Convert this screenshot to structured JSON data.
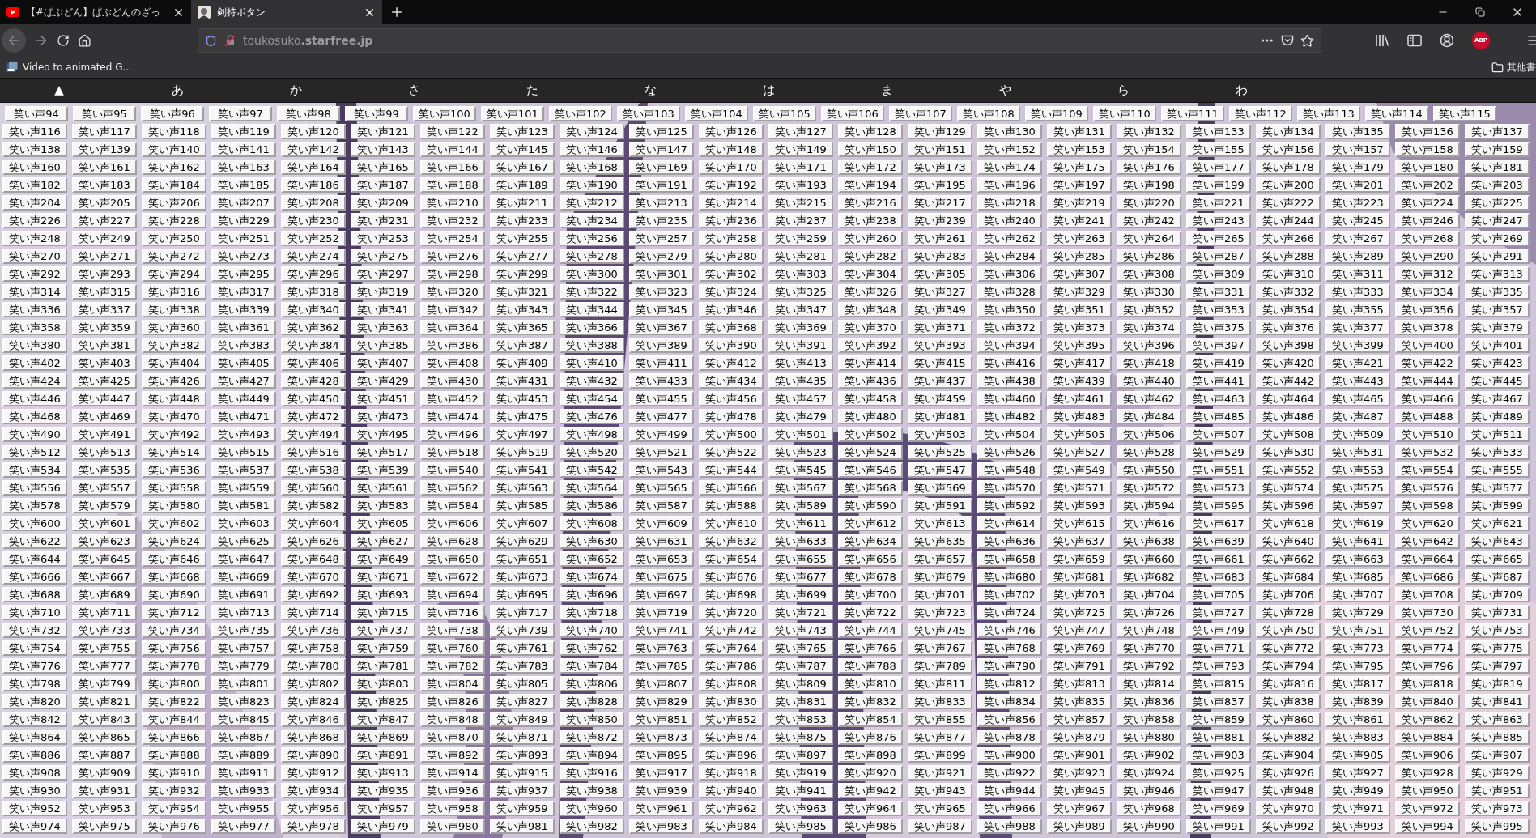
{
  "tabs": [
    {
      "title": "【#ぱぶどん】ぱぶどんのざっ",
      "kind": "youtube",
      "selected": false
    },
    {
      "title": "剣持ボタン",
      "kind": "avatar",
      "selected": true
    }
  ],
  "address": "toukosuko**.starfree.jp**",
  "addon_badge": "ABP",
  "bookmarks": [
    {
      "label": "Video to animated G..."
    }
  ],
  "other_bookmarks": "其他書",
  "index_links": [
    "▲",
    "あ",
    "か",
    "さ",
    "た",
    "な",
    "は",
    "ま",
    "や",
    "ら",
    "わ"
  ],
  "button_rows": [
    [
      "笑い声94",
      "笑い声95",
      "笑い声96",
      "笑い声97",
      "笑い声98",
      "笑い声99",
      "笑い声100",
      "笑い声101",
      "笑い声102",
      "笑い声103",
      "笑い声104",
      "笑い声105",
      "笑い声106",
      "笑い声107",
      "笑い声108",
      "笑い声109",
      "笑い声110",
      "笑い声111",
      "笑い声112",
      "笑い声113",
      "笑い声114",
      "笑い声115"
    ],
    [
      "笑い声116",
      "笑い声117",
      "笑い声118",
      "笑い声119",
      "笑い声120",
      "笑い声121",
      "笑い声122",
      "笑い声123",
      "笑い声124",
      "笑い声125",
      "笑い声126",
      "笑い声127",
      "笑い声128",
      "笑い声129",
      "笑い声130",
      "笑い声131",
      "笑い声132",
      "笑い声133",
      "笑い声134",
      "笑い声135",
      "笑い声136",
      "笑い声137"
    ],
    [
      "笑い声138",
      "笑い声139",
      "笑い声140",
      "笑い声141",
      "笑い声142",
      "笑い声143",
      "笑い声144",
      "笑い声145",
      "笑い声146",
      "笑い声147",
      "笑い声148",
      "笑い声149",
      "笑い声150",
      "笑い声151",
      "笑い声152",
      "笑い声153",
      "笑い声154",
      "笑い声155",
      "笑い声156",
      "笑い声157",
      "笑い声158",
      "笑い声159"
    ],
    [
      "笑い声160",
      "笑い声161",
      "笑い声162",
      "笑い声163",
      "笑い声164",
      "笑い声165",
      "笑い声166",
      "笑い声167",
      "笑い声168",
      "笑い声169",
      "笑い声170",
      "笑い声171",
      "笑い声172",
      "笑い声173",
      "笑い声174",
      "笑い声175",
      "笑い声176",
      "笑い声177",
      "笑い声178",
      "笑い声179",
      "笑い声180",
      "笑い声181"
    ],
    [
      "笑い声182",
      "笑い声183",
      "笑い声184",
      "笑い声185",
      "笑い声186",
      "笑い声187",
      "笑い声188",
      "笑い声189",
      "笑い声190",
      "笑い声191",
      "笑い声192",
      "笑い声193",
      "笑い声194",
      "笑い声195",
      "笑い声196",
      "笑い声197",
      "笑い声198",
      "笑い声199",
      "笑い声200",
      "笑い声201",
      "笑い声202",
      "笑い声203"
    ],
    [
      "笑い声204",
      "笑い声205",
      "笑い声206",
      "笑い声207",
      "笑い声208",
      "笑い声209",
      "笑い声210",
      "笑い声211",
      "笑い声212",
      "笑い声213",
      "笑い声214",
      "笑い声215",
      "笑い声216",
      "笑い声217",
      "笑い声218",
      "笑い声219",
      "笑い声220",
      "笑い声221",
      "笑い声222",
      "笑い声223",
      "笑い声224",
      "笑い声225"
    ],
    [
      "笑い声226",
      "笑い声227",
      "笑い声228",
      "笑い声229",
      "笑い声230",
      "笑い声231",
      "笑い声232",
      "笑い声233",
      "笑い声234",
      "笑い声235",
      "笑い声236",
      "笑い声237",
      "笑い声238",
      "笑い声239",
      "笑い声240",
      "笑い声241",
      "笑い声242",
      "笑い声243",
      "笑い声244",
      "笑い声245",
      "笑い声246",
      "笑い声247"
    ],
    [
      "笑い声248",
      "笑い声249",
      "笑い声250",
      "笑い声251",
      "笑い声252",
      "笑い声253",
      "笑い声254",
      "笑い声255",
      "笑い声256",
      "笑い声257",
      "笑い声258",
      "笑い声259",
      "笑い声260",
      "笑い声261",
      "笑い声262",
      "笑い声263",
      "笑い声264",
      "笑い声265",
      "笑い声266",
      "笑い声267",
      "笑い声268",
      "笑い声269"
    ],
    [
      "笑い声270",
      "笑い声271",
      "笑い声272",
      "笑い声273",
      "笑い声274",
      "笑い声275",
      "笑い声276",
      "笑い声277",
      "笑い声278",
      "笑い声279",
      "笑い声280",
      "笑い声281",
      "笑い声282",
      "笑い声283",
      "笑い声284",
      "笑い声285",
      "笑い声286",
      "笑い声287",
      "笑い声288",
      "笑い声289",
      "笑い声290",
      "笑い声291"
    ],
    [
      "笑い声292",
      "笑い声293",
      "笑い声294",
      "笑い声295",
      "笑い声296",
      "笑い声297",
      "笑い声298",
      "笑い声299",
      "笑い声300",
      "笑い声301",
      "笑い声302",
      "笑い声303",
      "笑い声304",
      "笑い声305",
      "笑い声306",
      "笑い声307",
      "笑い声308",
      "笑い声309",
      "笑い声310",
      "笑い声311",
      "笑い声312",
      "笑い声313"
    ],
    [
      "笑い声314",
      "笑い声315",
      "笑い声316",
      "笑い声317",
      "笑い声318",
      "笑い声319",
      "笑い声320",
      "笑い声321",
      "笑い声322",
      "笑い声323",
      "笑い声324",
      "笑い声325",
      "笑い声326",
      "笑い声327",
      "笑い声328",
      "笑い声329",
      "笑い声330",
      "笑い声331",
      "笑い声332",
      "笑い声333",
      "笑い声334",
      "笑い声335"
    ],
    [
      "笑い声336",
      "笑い声337",
      "笑い声338",
      "笑い声339",
      "笑い声340",
      "笑い声341",
      "笑い声342",
      "笑い声343",
      "笑い声344",
      "笑い声345",
      "笑い声346",
      "笑い声347",
      "笑い声348",
      "笑い声349",
      "笑い声350",
      "笑い声351",
      "笑い声352",
      "笑い声353",
      "笑い声354",
      "笑い声355",
      "笑い声356",
      "笑い声357"
    ],
    [
      "笑い声358",
      "笑い声359",
      "笑い声360",
      "笑い声361",
      "笑い声362",
      "笑い声363",
      "笑い声364",
      "笑い声365",
      "笑い声366",
      "笑い声367",
      "笑い声368",
      "笑い声369",
      "笑い声370",
      "笑い声371",
      "笑い声372",
      "笑い声373",
      "笑い声374",
      "笑い声375",
      "笑い声376",
      "笑い声377",
      "笑い声378",
      "笑い声379"
    ],
    [
      "笑い声380",
      "笑い声381",
      "笑い声382",
      "笑い声383",
      "笑い声384",
      "笑い声385",
      "笑い声386",
      "笑い声387",
      "笑い声388",
      "笑い声389",
      "笑い声390",
      "笑い声391",
      "笑い声392",
      "笑い声393",
      "笑い声394",
      "笑い声395",
      "笑い声396",
      "笑い声397",
      "笑い声398",
      "笑い声399",
      "笑い声400",
      "笑い声401"
    ],
    [
      "笑い声402",
      "笑い声403",
      "笑い声404",
      "笑い声405",
      "笑い声406",
      "笑い声407",
      "笑い声408",
      "笑い声409",
      "笑い声410",
      "笑い声411",
      "笑い声412",
      "笑い声413",
      "笑い声414",
      "笑い声415",
      "笑い声416",
      "笑い声417",
      "笑い声418",
      "笑い声419",
      "笑い声420",
      "笑い声421",
      "笑い声422",
      "笑い声423"
    ],
    [
      "笑い声424",
      "笑い声425",
      "笑い声426",
      "笑い声427",
      "笑い声428",
      "笑い声429",
      "笑い声430",
      "笑い声431",
      "笑い声432",
      "笑い声433",
      "笑い声434",
      "笑い声435",
      "笑い声436",
      "笑い声437",
      "笑い声438",
      "笑い声439",
      "笑い声440",
      "笑い声441",
      "笑い声442",
      "笑い声443",
      "笑い声444",
      "笑い声445"
    ],
    [
      "笑い声446",
      "笑い声447",
      "笑い声448",
      "笑い声449",
      "笑い声450",
      "笑い声451",
      "笑い声452",
      "笑い声453",
      "笑い声454",
      "笑い声455",
      "笑い声456",
      "笑い声457",
      "笑い声458",
      "笑い声459",
      "笑い声460",
      "笑い声461",
      "笑い声462",
      "笑い声463",
      "笑い声464",
      "笑い声465",
      "笑い声466",
      "笑い声467"
    ],
    [
      "笑い声468",
      "笑い声469",
      "笑い声470",
      "笑い声471",
      "笑い声472",
      "笑い声473",
      "笑い声474",
      "笑い声475",
      "笑い声476",
      "笑い声477",
      "笑い声478",
      "笑い声479",
      "笑い声480",
      "笑い声481",
      "笑い声482",
      "笑い声483",
      "笑い声484",
      "笑い声485",
      "笑い声486",
      "笑い声487",
      "笑い声488",
      "笑い声489"
    ],
    [
      "笑い声490",
      "笑い声491",
      "笑い声492",
      "笑い声493",
      "笑い声494",
      "笑い声495",
      "笑い声496",
      "笑い声497",
      "笑い声498",
      "笑い声499",
      "笑い声500",
      "笑い声501",
      "笑い声502",
      "笑い声503",
      "笑い声504",
      "笑い声505",
      "笑い声506",
      "笑い声507",
      "笑い声508",
      "笑い声509",
      "笑い声510",
      "笑い声511"
    ],
    [
      "笑い声512",
      "笑い声513",
      "笑い声514",
      "笑い声515",
      "笑い声516",
      "笑い声517",
      "笑い声518",
      "笑い声519",
      "笑い声520",
      "笑い声521",
      "笑い声522",
      "笑い声523",
      "笑い声524",
      "笑い声525",
      "笑い声526",
      "笑い声527",
      "笑い声528",
      "笑い声529",
      "笑い声530",
      "笑い声531",
      "笑い声532",
      "笑い声533"
    ],
    [
      "笑い声534",
      "笑い声535",
      "笑い声536",
      "笑い声537",
      "笑い声538",
      "笑い声539",
      "笑い声540",
      "笑い声541",
      "笑い声542",
      "笑い声543",
      "笑い声544",
      "笑い声545",
      "笑い声546",
      "笑い声547",
      "笑い声548",
      "笑い声549",
      "笑い声550",
      "笑い声551",
      "笑い声552",
      "笑い声553",
      "笑い声554",
      "笑い声555"
    ],
    [
      "笑い声556",
      "笑い声557",
      "笑い声558",
      "笑い声559",
      "笑い声560",
      "笑い声561",
      "笑い声562",
      "笑い声563",
      "笑い声564",
      "笑い声565",
      "笑い声566",
      "笑い声567",
      "笑い声568",
      "笑い声569",
      "笑い声570",
      "笑い声571",
      "笑い声572",
      "笑い声573",
      "笑い声574",
      "笑い声575",
      "笑い声576",
      "笑い声577"
    ],
    [
      "笑い声578",
      "笑い声579",
      "笑い声580",
      "笑い声581",
      "笑い声582",
      "笑い声583",
      "笑い声584",
      "笑い声585",
      "笑い声586",
      "笑い声587",
      "笑い声588",
      "笑い声589",
      "笑い声590",
      "笑い声591",
      "笑い声592",
      "笑い声593",
      "笑い声594",
      "笑い声595",
      "笑い声596",
      "笑い声597",
      "笑い声598",
      "笑い声599"
    ],
    [
      "笑い声600",
      "笑い声601",
      "笑い声602",
      "笑い声603",
      "笑い声604",
      "笑い声605",
      "笑い声606",
      "笑い声607",
      "笑い声608",
      "笑い声609",
      "笑い声610",
      "笑い声611",
      "笑い声612",
      "笑い声613",
      "笑い声614",
      "笑い声615",
      "笑い声616",
      "笑い声617",
      "笑い声618",
      "笑い声619",
      "笑い声620",
      "笑い声621"
    ],
    [
      "笑い声622",
      "笑い声623",
      "笑い声624",
      "笑い声625",
      "笑い声626",
      "笑い声627",
      "笑い声628",
      "笑い声629",
      "笑い声630",
      "笑い声631",
      "笑い声632",
      "笑い声633",
      "笑い声634",
      "笑い声635",
      "笑い声636",
      "笑い声637",
      "笑い声638",
      "笑い声639",
      "笑い声640",
      "笑い声641",
      "笑い声642",
      "笑い声643"
    ],
    [
      "笑い声644",
      "笑い声645",
      "笑い声646",
      "笑い声647",
      "笑い声648",
      "笑い声649",
      "笑い声650",
      "笑い声651",
      "笑い声652",
      "笑い声653",
      "笑い声654",
      "笑い声655",
      "笑い声656",
      "笑い声657",
      "笑い声658",
      "笑い声659",
      "笑い声660",
      "笑い声661",
      "笑い声662",
      "笑い声663",
      "笑い声664",
      "笑い声665"
    ],
    [
      "笑い声666",
      "笑い声667",
      "笑い声668",
      "笑い声669",
      "笑い声670",
      "笑い声671",
      "笑い声672",
      "笑い声673",
      "笑い声674",
      "笑い声675",
      "笑い声676",
      "笑い声677",
      "笑い声678",
      "笑い声679",
      "笑い声680",
      "笑い声681",
      "笑い声682",
      "笑い声683",
      "笑い声684",
      "笑い声685",
      "笑い声686",
      "笑い声687"
    ],
    [
      "笑い声688",
      "笑い声689",
      "笑い声690",
      "笑い声691",
      "笑い声692",
      "笑い声693",
      "笑い声694",
      "笑い声695",
      "笑い声696",
      "笑い声697",
      "笑い声698",
      "笑い声699",
      "笑い声700",
      "笑い声701",
      "笑い声702",
      "笑い声703",
      "笑い声704",
      "笑い声705",
      "笑い声706",
      "笑い声707",
      "笑い声708",
      "笑い声709"
    ],
    [
      "笑い声710",
      "笑い声711",
      "笑い声712",
      "笑い声713",
      "笑い声714",
      "笑い声715",
      "笑い声716",
      "笑い声717",
      "笑い声718",
      "笑い声719",
      "笑い声720",
      "笑い声721",
      "笑い声722",
      "笑い声723",
      "笑い声724",
      "笑い声725",
      "笑い声726",
      "笑い声727",
      "笑い声728",
      "笑い声729",
      "笑い声730",
      "笑い声731"
    ],
    [
      "笑い声732",
      "笑い声733",
      "笑い声734",
      "笑い声735",
      "笑い声736",
      "笑い声737",
      "笑い声738",
      "笑い声739",
      "笑い声740",
      "笑い声741",
      "笑い声742",
      "笑い声743",
      "笑い声744",
      "笑い声745",
      "笑い声746",
      "笑い声747",
      "笑い声748",
      "笑い声749",
      "笑い声750",
      "笑い声751",
      "笑い声752",
      "笑い声753"
    ],
    [
      "笑い声754",
      "笑い声755",
      "笑い声756",
      "笑い声757",
      "笑い声758",
      "笑い声759",
      "笑い声760",
      "笑い声761",
      "笑い声762",
      "笑い声763",
      "笑い声764",
      "笑い声765",
      "笑い声766",
      "笑い声767",
      "笑い声768",
      "笑い声769",
      "笑い声770",
      "笑い声771",
      "笑い声772",
      "笑い声773",
      "笑い声774",
      "笑い声775"
    ],
    [
      "笑い声776",
      "笑い声777",
      "笑い声778",
      "笑い声779",
      "笑い声780",
      "笑い声781",
      "笑い声782",
      "笑い声783",
      "笑い声784",
      "笑い声785",
      "笑い声786",
      "笑い声787",
      "笑い声788",
      "笑い声789",
      "笑い声790",
      "笑い声791",
      "笑い声792",
      "笑い声793",
      "笑い声794",
      "笑い声795",
      "笑い声796",
      "笑い声797"
    ],
    [
      "笑い声798",
      "笑い声799",
      "笑い声800",
      "笑い声801",
      "笑い声802",
      "笑い声803",
      "笑い声804",
      "笑い声805",
      "笑い声806",
      "笑い声807",
      "笑い声808",
      "笑い声809",
      "笑い声810",
      "笑い声811",
      "笑い声812",
      "笑い声813",
      "笑い声814",
      "笑い声815",
      "笑い声816",
      "笑い声817",
      "笑い声818",
      "笑い声819"
    ],
    [
      "笑い声820",
      "笑い声821",
      "笑い声822",
      "笑い声823",
      "笑い声824",
      "笑い声825",
      "笑い声826",
      "笑い声827",
      "笑い声828",
      "笑い声829",
      "笑い声830",
      "笑い声831",
      "笑い声832",
      "笑い声833",
      "笑い声834",
      "笑い声835",
      "笑い声836",
      "笑い声837",
      "笑い声838",
      "笑い声839",
      "笑い声840",
      "笑い声841"
    ],
    [
      "笑い声842",
      "笑い声843",
      "笑い声844",
      "笑い声845",
      "笑い声846",
      "笑い声847",
      "笑い声848",
      "笑い声849",
      "笑い声850",
      "笑い声851",
      "笑い声852",
      "笑い声853",
      "笑い声854",
      "笑い声855",
      "笑い声856",
      "笑い声857",
      "笑い声858",
      "笑い声859",
      "笑い声860",
      "笑い声861",
      "笑い声862",
      "笑い声863"
    ],
    [
      "笑い声864",
      "笑い声865",
      "笑い声866",
      "笑い声867",
      "笑い声868",
      "笑い声869",
      "笑い声870",
      "笑い声871",
      "笑い声872",
      "笑い声873",
      "笑い声874",
      "笑い声875",
      "笑い声876",
      "笑い声877",
      "笑い声878",
      "笑い声879",
      "笑い声880",
      "笑い声881",
      "笑い声882",
      "笑い声883",
      "笑い声884",
      "笑い声885"
    ],
    [
      "笑い声886",
      "笑い声887",
      "笑い声888",
      "笑い声889",
      "笑い声890",
      "笑い声891",
      "笑い声892",
      "笑い声893",
      "笑い声894",
      "笑い声895",
      "笑い声896",
      "笑い声897",
      "笑い声898",
      "笑い声899",
      "笑い声900",
      "笑い声901",
      "笑い声902",
      "笑い声903",
      "笑い声904",
      "笑い声905",
      "笑い声906",
      "笑い声907"
    ],
    [
      "笑い声908",
      "笑い声909",
      "笑い声910",
      "笑い声911",
      "笑い声912",
      "笑い声913",
      "笑い声914",
      "笑い声915",
      "笑い声916",
      "笑い声917",
      "笑い声918",
      "笑い声919",
      "笑い声920",
      "笑い声921",
      "笑い声922",
      "笑い声923",
      "笑い声924",
      "笑い声925",
      "笑い声926",
      "笑い声927",
      "笑い声928",
      "笑い声929"
    ],
    [
      "笑い声930",
      "笑い声931",
      "笑い声932",
      "笑い声933",
      "笑い声934",
      "笑い声935",
      "笑い声936",
      "笑い声937",
      "笑い声938",
      "笑い声939",
      "笑い声940",
      "笑い声941",
      "笑い声942",
      "笑い声943",
      "笑い声944",
      "笑い声945",
      "笑い声946",
      "笑い声947",
      "笑い声948",
      "笑い声949",
      "笑い声950",
      "笑い声951"
    ],
    [
      "笑い声952",
      "笑い声953",
      "笑い声954",
      "笑い声955",
      "笑い声956",
      "笑い声957",
      "笑い声958",
      "笑い声959",
      "笑い声960",
      "笑い声961",
      "笑い声962",
      "笑い声963",
      "笑い声964",
      "笑い声965",
      "笑い声966",
      "笑い声967",
      "笑い声968",
      "笑い声969",
      "笑い声970",
      "笑い声971",
      "笑い声972",
      "笑い声973"
    ],
    [
      "笑い声974",
      "笑い声975",
      "笑い声976",
      "笑い声977",
      "笑い声978",
      "笑い声979",
      "笑い声980",
      "笑い声981",
      "笑い声982",
      "笑い声983",
      "笑い声984",
      "笑い声985",
      "笑い声986",
      "笑い声987",
      "笑い声988",
      "笑い声989",
      "笑い声990",
      "笑い声991",
      "笑い声992",
      "笑い声993",
      "笑い声994",
      "笑い声995"
    ]
  ]
}
